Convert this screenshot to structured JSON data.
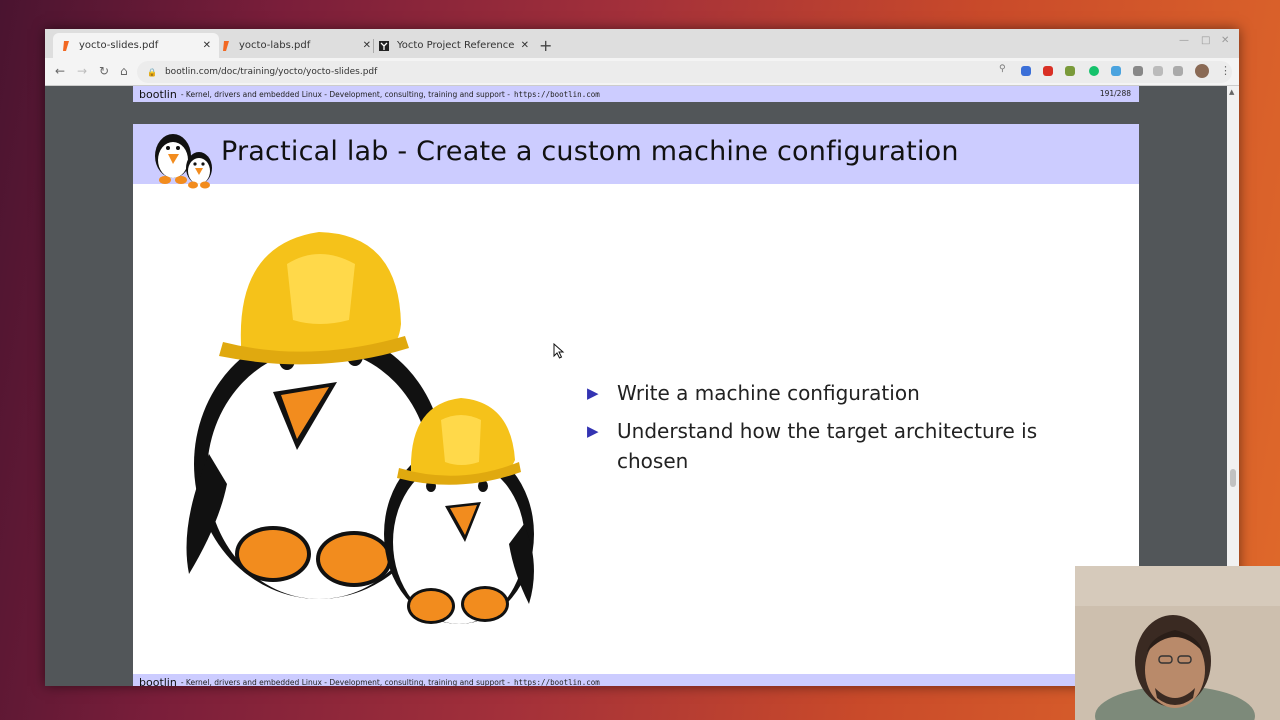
{
  "browser": {
    "tabs": [
      {
        "title": "yocto-slides.pdf",
        "active": true
      },
      {
        "title": "yocto-labs.pdf",
        "active": false
      },
      {
        "title": "Yocto Project Reference M",
        "active": false
      }
    ],
    "new_tab": "+",
    "address": "bootlin.com/doc/training/yocto/yocto-slides.pdf",
    "colors": {
      "accent_orange": "#f26822",
      "yocto_tab_icon": "#222222"
    }
  },
  "slide": {
    "strip_brand": "bootlin",
    "strip_text": "- Kernel, drivers and embedded Linux - Development, consulting, training and support -",
    "strip_url": "https://bootlin.com",
    "page_number": "191/288",
    "title": "Practical lab - Create a custom machine configuration",
    "bullets": [
      "Write a machine configuration",
      "Understand how the target architecture is chosen"
    ],
    "bullet_symbol": "▶",
    "colors": {
      "header_bg": "#ccccff",
      "bullet": "#3333b2"
    }
  }
}
